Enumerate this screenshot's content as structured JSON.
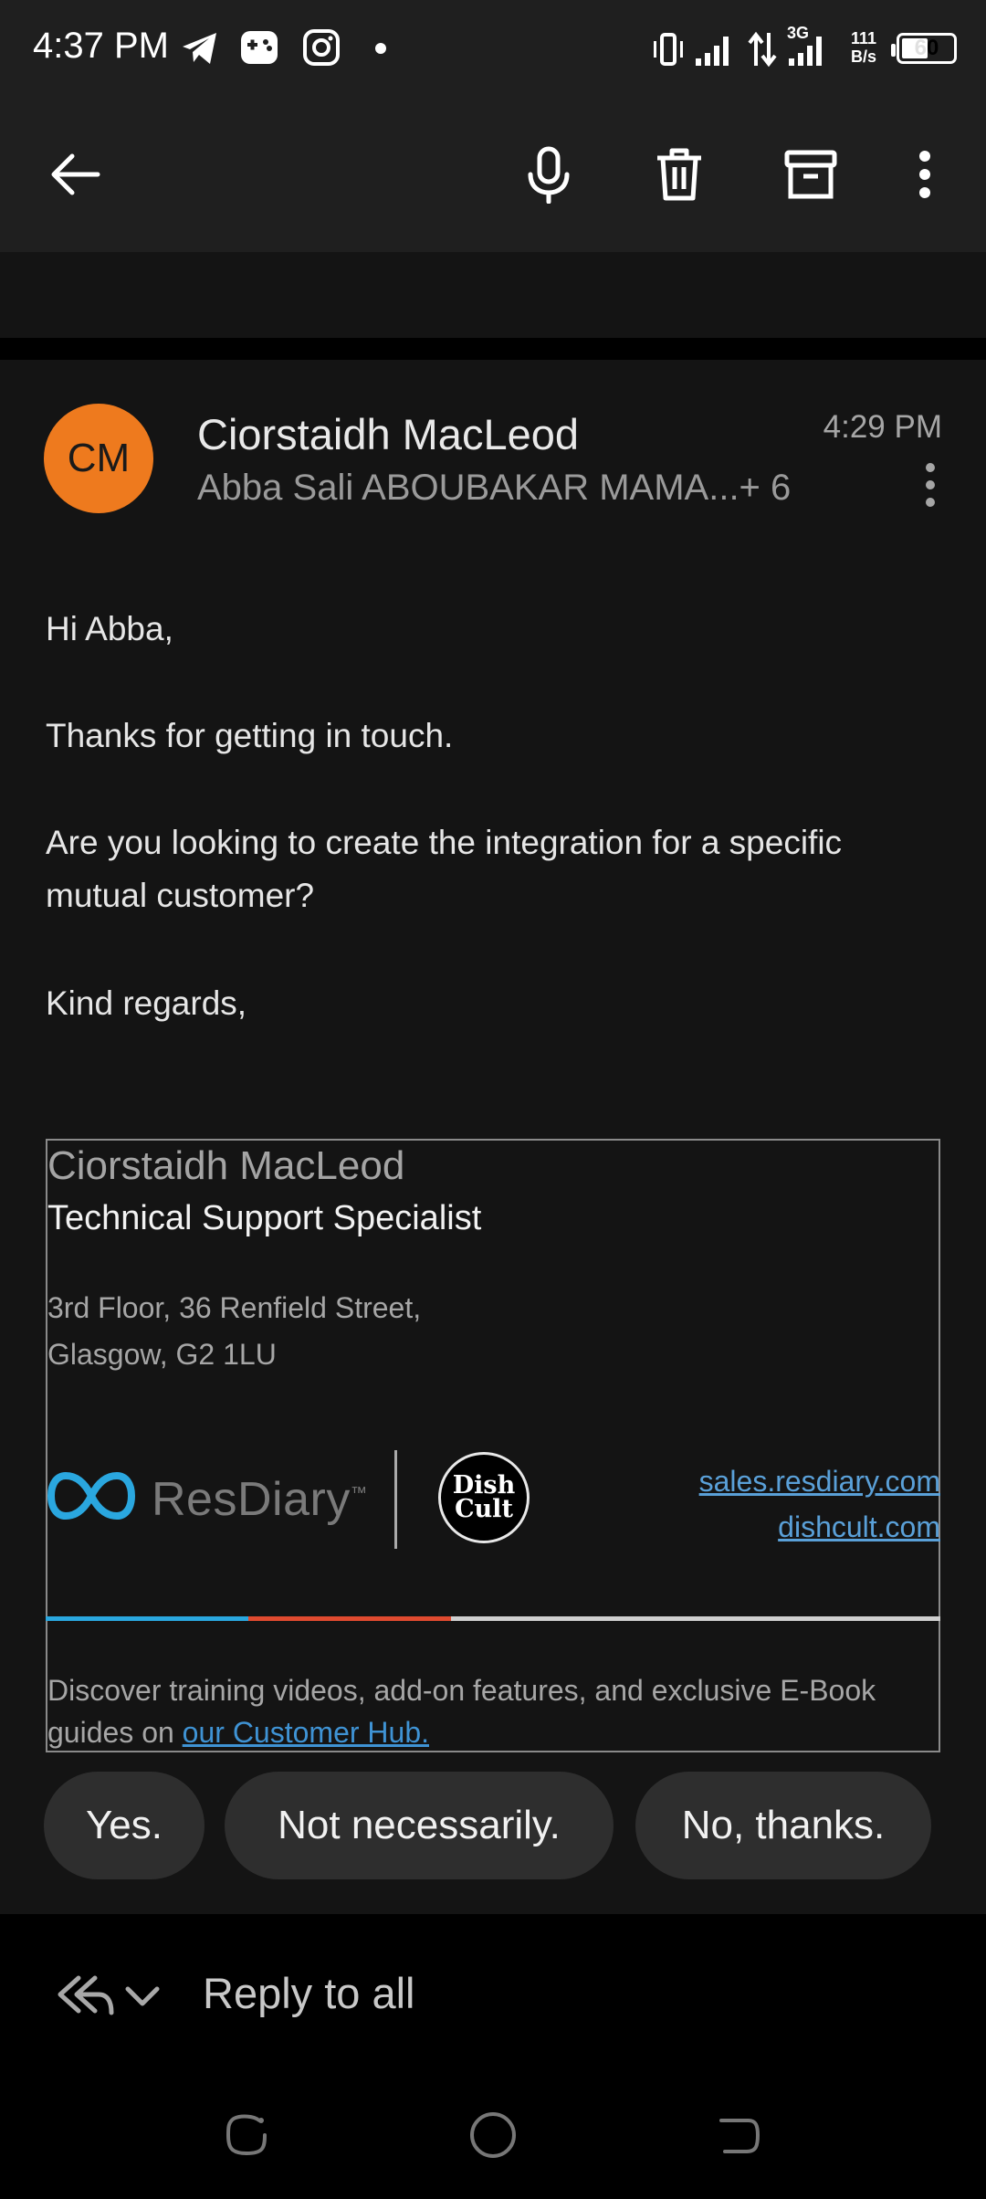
{
  "status_bar": {
    "time": "4:37 PM",
    "net_speed_value": "111",
    "net_speed_unit": "B/s",
    "network_type": "3G",
    "battery": "60",
    "icons": [
      "telegram-icon",
      "game-icon",
      "instagram-icon",
      "notification-dot-icon",
      "vibrate-icon",
      "signal-icon",
      "data-arrows-icon",
      "signal-3g-icon",
      "battery-icon"
    ]
  },
  "toolbar": {
    "icons": [
      "back-arrow-icon",
      "microphone-icon",
      "delete-icon",
      "archive-icon",
      "more-vert-icon"
    ]
  },
  "message": {
    "avatar_initials": "CM",
    "avatar_color": "#ee7a1e",
    "sender": "Ciorstaidh MacLeod",
    "recipients": "Abba Sali ABOUBAKAR MAMA...+ 6",
    "time": "4:29 PM",
    "greeting": "Hi Abba,",
    "line1": "Thanks for getting in touch.",
    "line2a": "Are you looking to create the integration for a specific",
    "line2b": "mutual customer?",
    "closing": "Kind regards,"
  },
  "signature": {
    "name": "Ciorstaidh MacLeod",
    "title": "Technical Support Specialist",
    "address_line1": "3rd Floor, 36 Renfield Street,",
    "address_line2": "Glasgow, G2 1LU",
    "logo_resdiary": "ResDiary",
    "logo_tm": "™",
    "logo_dishcult_line1": "Dish",
    "logo_dishcult_line2": "Cult",
    "link1": "sales.resdiary.com",
    "link2": "dishcult.com",
    "footer_prefix": "Discover training videos, add-on features, and exclusive E-Book guides on",
    "footer_link": "our Customer Hub.",
    "bar_colors": [
      "#2aa7df",
      "#e04a2f",
      "#cfcfcf"
    ]
  },
  "smart_replies": [
    "Yes.",
    "Not necessarily.",
    "No, thanks."
  ],
  "reply": {
    "label": "Reply to all"
  },
  "nav": {
    "icons": [
      "recents-icon",
      "home-icon",
      "back-icon"
    ]
  }
}
